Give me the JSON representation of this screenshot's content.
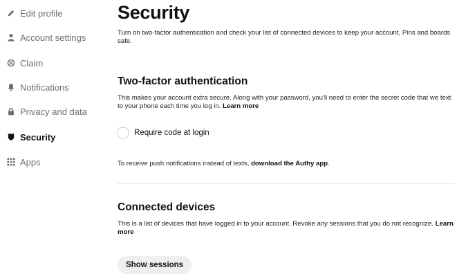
{
  "sidebar": {
    "items": [
      {
        "label": "Edit profile",
        "icon": "pencil-icon"
      },
      {
        "label": "Account settings",
        "icon": "person-icon"
      },
      {
        "label": "Claim",
        "icon": "claim-icon"
      },
      {
        "label": "Notifications",
        "icon": "bell-icon"
      },
      {
        "label": "Privacy and data",
        "icon": "lock-icon"
      },
      {
        "label": "Security",
        "icon": "shield-icon",
        "active": true
      },
      {
        "label": "Apps",
        "icon": "grid-icon"
      }
    ]
  },
  "main": {
    "title": "Security",
    "intro": "Turn on two-factor authentication and check your list of connected devices to keep your account, Pins and boards safe.",
    "two_factor": {
      "title": "Two-factor authentication",
      "description": "This makes your account extra secure. Along with your password, you'll need to enter the secret code that we text to your phone each time you log in.",
      "learn_more": "Learn more",
      "checkbox_label": "Require code at login",
      "checkbox_checked": false,
      "push_note": "To receive push notifications instead of texts,",
      "authy_link": "download the Authy app"
    },
    "devices": {
      "title": "Connected devices",
      "description": "This is a list of devices that have logged in to your account. Revoke any sessions that you do not recognize.",
      "learn_more": "Learn more",
      "button": "Show sessions"
    }
  },
  "colors": {
    "text": "#111111",
    "muted": "#6f6f6f",
    "button_bg": "#efefef",
    "divider": "#e6e6e6"
  }
}
